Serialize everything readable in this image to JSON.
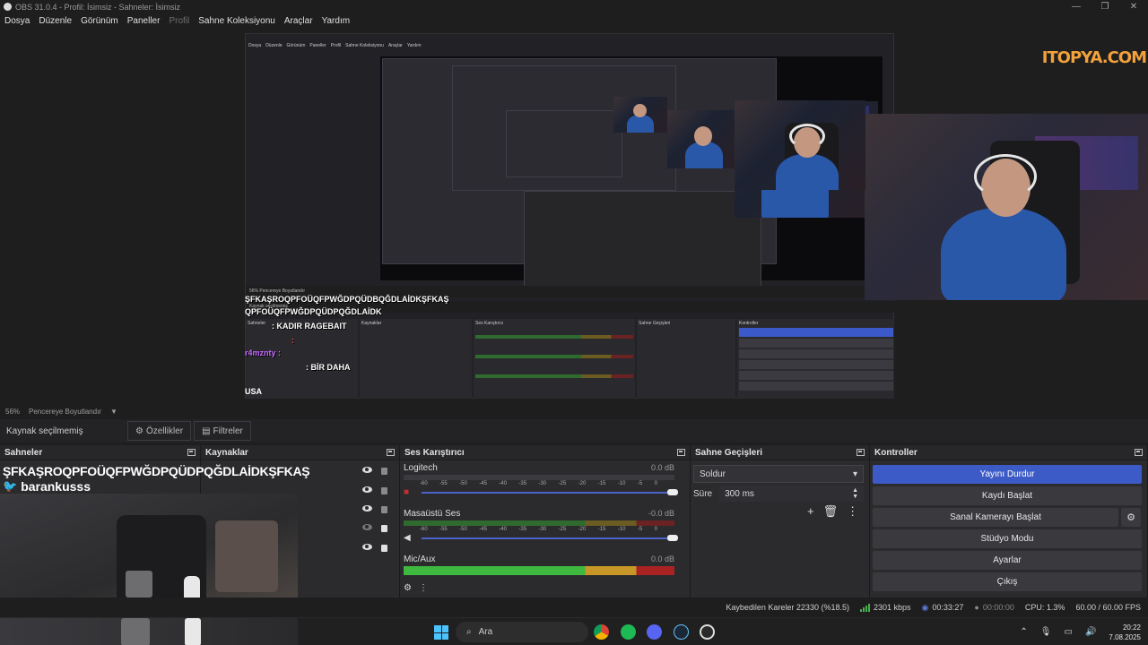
{
  "window": {
    "title": "OBS 31.0.4 - Profil: İsimsiz - Sahneler: İsimsiz",
    "controls": [
      "—",
      "❐",
      "✕"
    ]
  },
  "menu": [
    "Dosya",
    "Düzenle",
    "Görünüm",
    "Paneller",
    "Profil",
    "Sahne Koleksiyonu",
    "Araçlar",
    "Yardım"
  ],
  "preview": {
    "zoom": "56%",
    "fit_label": "Pencereye Boyutlandır",
    "logo": "ITOPYA.COM",
    "overlay_lines": [
      "ŞFKAŞROQPFOÜQFPWĞDPQÜDBQĞDLAİDKŞFKAŞ",
      "QPFOÜQFPWĞDPQÜDPQĞDLAİDK",
      ": KADIR RAGEBAIT",
      ":",
      "r4mznty :",
      ": BİR DAHA"
    ],
    "country": "USA"
  },
  "source_bar": {
    "label": "Kaynak seçilmemiş",
    "properties": "Özellikler",
    "filters": "Filtreler"
  },
  "docks": {
    "scenes": {
      "title": "Sahneler",
      "scene_name": "ŞFKAŞROQPFOÜQFPWĞDPQÜDPQĞDLAİDKŞFKAŞ",
      "twitter": "barankusss"
    },
    "sources": {
      "title": "Kaynaklar"
    },
    "mixer": {
      "title": "Ses Karıştırıcı",
      "ticks": [
        "-60",
        "-55",
        "-50",
        "-45",
        "-40",
        "-35",
        "-30",
        "-25",
        "-20",
        "-15",
        "-10",
        "-5",
        "0"
      ],
      "channels": [
        {
          "name": "Logitech",
          "db": "0.0 dB",
          "level": 0.0,
          "muted": true
        },
        {
          "name": "Masaüstü Ses",
          "db": "-0.0 dB",
          "level": 1.0,
          "muted": false
        },
        {
          "name": "Mic/Aux",
          "db": "0.0 dB",
          "level": 0.7,
          "muted": false
        }
      ]
    },
    "transitions": {
      "title": "Sahne Geçişleri",
      "selected": "Soldur",
      "duration_label": "Süre",
      "duration_value": "300 ms"
    },
    "controls": {
      "title": "Kontroller",
      "buttons": [
        "Yayını Durdur",
        "Kaydı Başlat",
        "Sanal Kamerayı Başlat",
        "Stüdyo Modu",
        "Ayarlar",
        "Çıkış"
      ]
    }
  },
  "status": {
    "dropped": "Kaybedilen Kareler 22330 (%18.5)",
    "bitrate": "2301 kbps",
    "stream_time": "00:33:27",
    "rec_time": "00:00:00",
    "cpu": "CPU: 1.3%",
    "fps": "60.00 / 60.00 FPS"
  },
  "taskbar": {
    "search_placeholder": "Ara",
    "time": "20:22",
    "date": "7.08.2025"
  },
  "colors": {
    "accent": "#3d5bc7",
    "meter_green": "#4caf50",
    "meter_yellow": "#c9a227",
    "meter_red": "#c33",
    "logo": "#f2a13b"
  }
}
